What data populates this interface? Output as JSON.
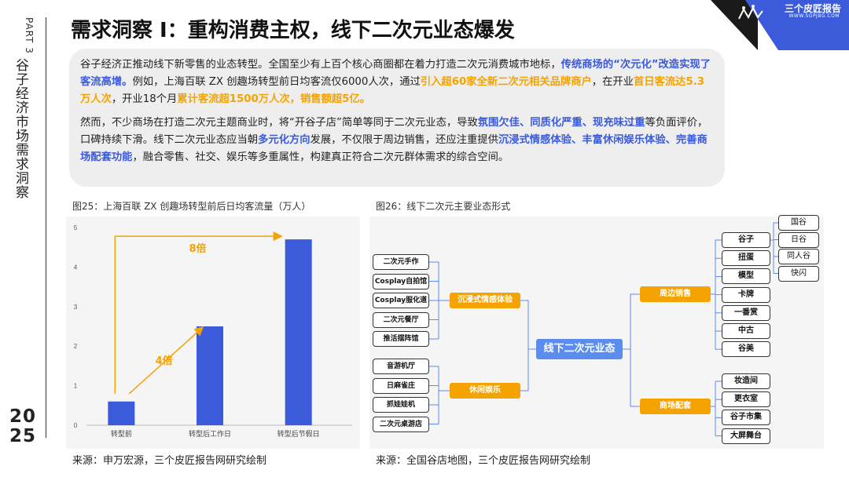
{
  "side": {
    "part": "PART 3",
    "title": "谷子经济市场需求洞察",
    "year_top": "20",
    "year_bottom": "25"
  },
  "header": {
    "title": "需求洞察 Ⅰ：重构消费主权，线下二次元业态爆发"
  },
  "logo": {
    "brand": "三个皮匠报告",
    "url": "WWW.SGPJBG.COM"
  },
  "body": {
    "para1": [
      {
        "t": "谷子经济正推动线下新零售的业态转型。全国至少有上百个核心商圈都在着力打造二次元消费城市地标，",
        "s": ""
      },
      {
        "t": "传统商场的“次元化”改造实现了客流高增。",
        "s": "blue"
      },
      {
        "t": "例如，上海百联 ZX 创趣场转型前日均客流仅6000人次，通过",
        "s": ""
      },
      {
        "t": "引入超60家全新二次元相关品牌商户",
        "s": "orange"
      },
      {
        "t": "，在开业",
        "s": ""
      },
      {
        "t": "首日客流达5.3万人次",
        "s": "orange"
      },
      {
        "t": "，开业18个月",
        "s": ""
      },
      {
        "t": "累计客流超1500万人次，销售额超5亿。",
        "s": "orange"
      }
    ],
    "para2": [
      {
        "t": "然而，不少商场在打造二次元主题商业时，将“开谷子店”简单等同于二次元业态，导致",
        "s": ""
      },
      {
        "t": "氛围欠佳、同质化严重、现充味过重",
        "s": "blue"
      },
      {
        "t": "等负面评价，口碑持续下滑。线下二次元业态应当朝",
        "s": ""
      },
      {
        "t": "多元化方向",
        "s": "blue"
      },
      {
        "t": "发展，不仅限于周边销售，还应注重提供",
        "s": ""
      },
      {
        "t": "沉浸式情感体验、丰富休闲娱乐体验、完善商场配套功能",
        "s": "blue"
      },
      {
        "t": "，融合零售、社交、娱乐等多重属性，构建真正符合二次元群体需求的综合空间。",
        "s": ""
      }
    ]
  },
  "fig25": {
    "caption": "图25：上海百联 ZX 创趣场转型前后日均客流量（万人）",
    "source": "来源：申万宏源，三个皮匠报告网研究绘制"
  },
  "fig26": {
    "caption": "图26：线下二次元主要业态形式",
    "source": "来源：全国谷店地图，三个皮匠报告网研究绘制"
  },
  "chart_data": {
    "type": "bar",
    "categories": [
      "转型前",
      "转型后工作日",
      "转型后节假日"
    ],
    "values": [
      0.6,
      2.5,
      4.7
    ],
    "ylim": [
      0,
      5
    ],
    "yticks": [
      0,
      1,
      2,
      3,
      4,
      5
    ],
    "bar_color": "#3b5bdb",
    "annotations": [
      {
        "text": "4倍",
        "from": "转型前",
        "to": "转型后工作日",
        "color": "#f5a300"
      },
      {
        "text": "8倍",
        "from": "转型前",
        "to": "转型后节假日",
        "color": "#f5a300"
      }
    ],
    "grid": false
  },
  "diagram": {
    "center": "线下二次元业态",
    "left_groups": [
      {
        "label": "沉浸式情感体验",
        "items": [
          "二次元手作",
          "Cosplay自拍馆",
          "Cosplay服化道",
          "二次元餐厅",
          "推活摆阵馆"
        ]
      },
      {
        "label": "休闲娱乐",
        "items": [
          "音游机厅",
          "日麻雀庄",
          "抓娃娃机",
          "二次元桌游店"
        ]
      }
    ],
    "right_groups": [
      {
        "label": "周边销售",
        "items": [
          "谷子",
          "扭蛋",
          "模型",
          "卡牌",
          "一番赏",
          "中古",
          "谷美"
        ]
      },
      {
        "label": "商场配套",
        "items": [
          "妆造间",
          "更衣室",
          "谷子市集",
          "大屏舞台"
        ]
      }
    ],
    "guzi_sub": [
      "国谷",
      "日谷",
      "同人谷",
      "快闪"
    ],
    "accent": "#f5a300",
    "center_color": "#5b8def",
    "line_color": "#5b8def"
  }
}
